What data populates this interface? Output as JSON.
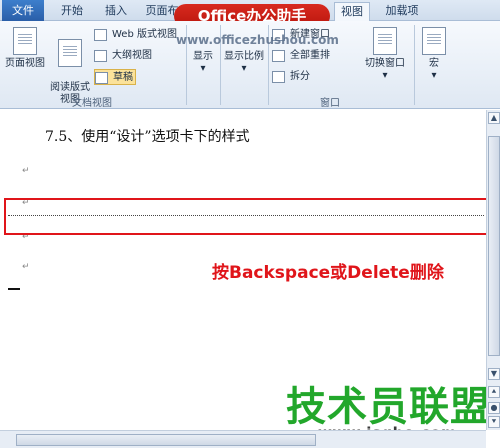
{
  "tabs": {
    "file": "文件",
    "home": "开始",
    "insert": "插入",
    "page_layout": "页面布",
    "view": "视图",
    "addins": "加载项"
  },
  "overlay": {
    "banner": "Office办公助手",
    "watermark_url": "www.officezhushou.com"
  },
  "ribbon": {
    "doc_views": {
      "print_layout": "页面视图",
      "full_screen_reading": "阅读版式\n视图",
      "web_layout": "Web 版式视图",
      "outline": "大纲视图",
      "draft": "草稿",
      "group_label": "文档视图"
    },
    "show": "显示",
    "zoom": "显示比例",
    "window": {
      "new_window": "新建窗口",
      "arrange_all": "全部重排",
      "split": "拆分",
      "switch_windows": "切换窗口",
      "group_label": "窗口"
    },
    "macros": "宏"
  },
  "document": {
    "heading": "7.5、使用“设计”选项卡下的样式",
    "paragraph_mark": "↵"
  },
  "annotation": "按Backspace或Delete删除",
  "brand": {
    "name": "技术员联盟",
    "url": "www.jsgho.com"
  },
  "colors": {
    "accent_red": "#e0151a",
    "brand_green": "#22a72b",
    "ribbon_bg": "#dfe8f3"
  }
}
